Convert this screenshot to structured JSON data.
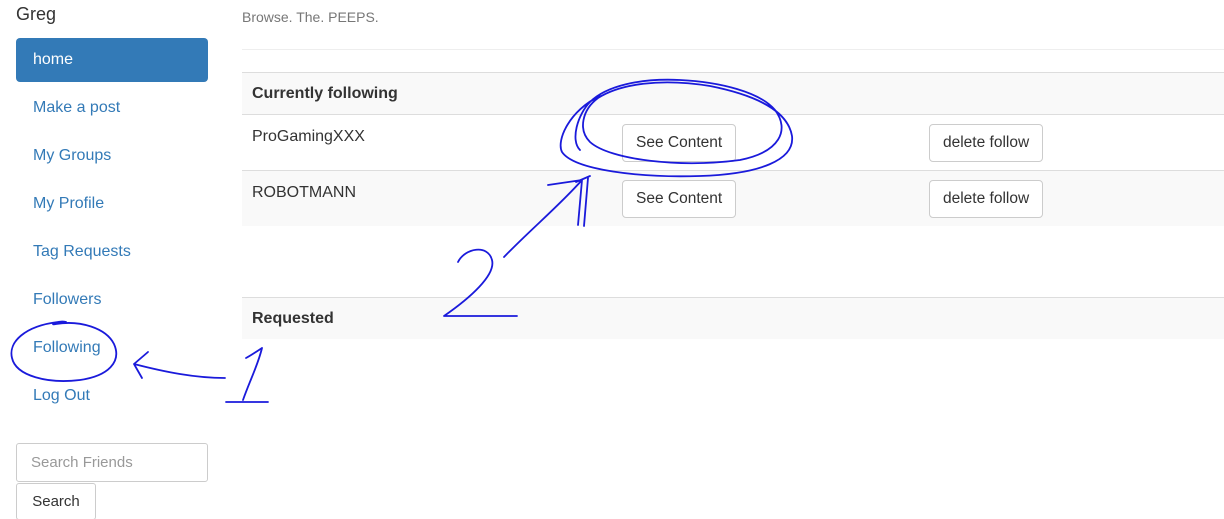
{
  "sidebar": {
    "username": "Greg",
    "items": [
      {
        "label": "home",
        "active": true
      },
      {
        "label": "Make a post"
      },
      {
        "label": "My Groups"
      },
      {
        "label": "My Profile"
      },
      {
        "label": "Tag Requests"
      },
      {
        "label": "Followers"
      },
      {
        "label": "Following"
      },
      {
        "label": "Log Out"
      }
    ],
    "search": {
      "placeholder": "Search Friends",
      "button_label": "Search"
    }
  },
  "main": {
    "tagline": "Browse. The. PEEPS.",
    "following": {
      "header": "Currently following",
      "rows": [
        {
          "name": "ProGamingXXX",
          "see_label": "See Content",
          "delete_label": "delete follow"
        },
        {
          "name": "ROBOTMANN",
          "see_label": "See Content",
          "delete_label": "delete follow"
        }
      ]
    },
    "requested": {
      "header": "Requested"
    }
  },
  "annotations": {
    "step1": "1",
    "step2": "2",
    "ink_color": "#1a1adb"
  },
  "colors": {
    "accent": "#337ab7"
  }
}
